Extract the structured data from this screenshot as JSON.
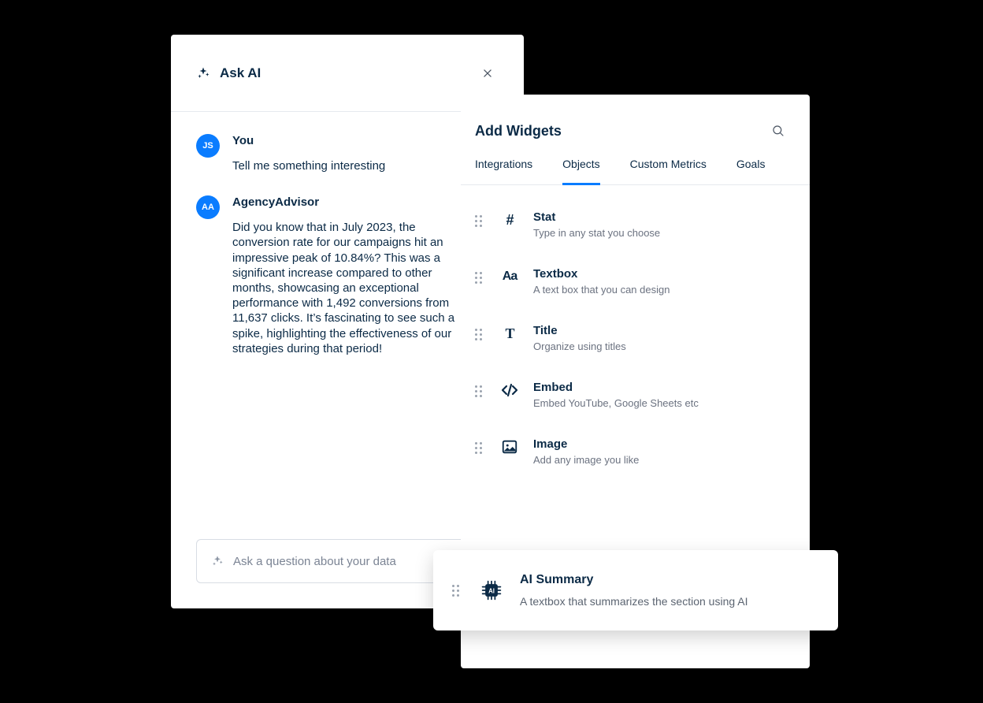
{
  "ask_ai": {
    "title": "Ask AI",
    "input_placeholder": "Ask a question about your data",
    "messages": [
      {
        "avatar_initials": "JS",
        "name": "You",
        "text": "Tell me something interesting"
      },
      {
        "avatar_initials": "AA",
        "name": "AgencyAdvisor",
        "text": "Did you know that in July 2023, the conversion rate for our campaigns hit an impressive peak of 10.84%? This was a significant increase compared to other months, showcasing an exceptional performance with 1,492 conversions from 11,637 clicks. It’s fascinating to see such a spike, highlighting the effectiveness of our strategies during that period!"
      }
    ]
  },
  "widgets": {
    "title": "Add Widgets",
    "tabs": [
      "Integrations",
      "Objects",
      "Custom Metrics",
      "Goals"
    ],
    "active_tab_index": 1,
    "items": [
      {
        "icon": "#",
        "name": "Stat",
        "desc": "Type in any stat you choose"
      },
      {
        "icon": "Aa",
        "name": "Textbox",
        "desc": "A text box that you can design"
      },
      {
        "icon": "T",
        "name": "Title",
        "desc": "Organize using titles"
      },
      {
        "icon": "</>",
        "name": "Embed",
        "desc": "Embed YouTube, Google Sheets etc"
      },
      {
        "icon": "img",
        "name": "Image",
        "desc": "Add any image you like"
      }
    ]
  },
  "floating": {
    "title": "AI Summary",
    "desc": "A textbox that summarizes the section using AI"
  }
}
